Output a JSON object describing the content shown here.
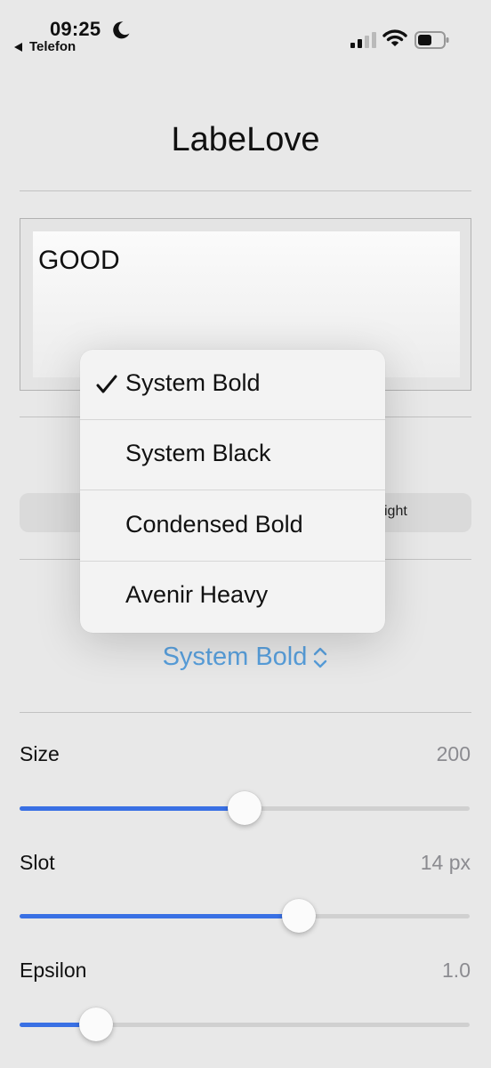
{
  "status_bar": {
    "time": "09:25",
    "back_label": "Telefon",
    "moon_icon": "moon-icon",
    "signal_icon": "cellular-signal-icon",
    "wifi_icon": "wifi-icon",
    "battery_icon": "battery-icon"
  },
  "app": {
    "title": "LabeLove"
  },
  "preview": {
    "text": "GOOD"
  },
  "segmented": {
    "right_label_fragment": "ight"
  },
  "font_picker": {
    "selected": "System Bold",
    "icon": "chevron-up-down-icon",
    "color": "#5aa2e0"
  },
  "menu": {
    "items": [
      {
        "label": "System Bold",
        "checked": true
      },
      {
        "label": "System Black",
        "checked": false
      },
      {
        "label": "Condensed Bold",
        "checked": false
      },
      {
        "label": "Avenir Heavy",
        "checked": false
      }
    ]
  },
  "sliders": [
    {
      "label": "Size",
      "value": "200",
      "fraction": 0.5
    },
    {
      "label": "Slot",
      "value": "14 px",
      "fraction": 0.62
    },
    {
      "label": "Epsilon",
      "value": "1.0",
      "fraction": 0.17
    }
  ],
  "colors": {
    "accent": "#3a72e8",
    "background": "#ececec"
  }
}
